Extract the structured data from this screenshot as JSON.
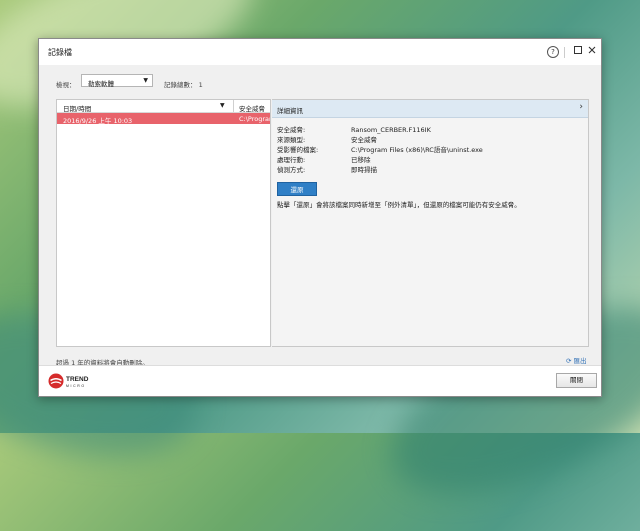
{
  "window": {
    "title": "記錄檔"
  },
  "filter": {
    "label": "檢視：",
    "selected": "勒索軟體"
  },
  "record_count": {
    "label": "記錄總數：",
    "value": "1"
  },
  "list": {
    "columns": [
      "日期/時間",
      "安全威脅"
    ],
    "rows": [
      {
        "datetime": "2016/9/26 上午 10:03",
        "threat": "C:\\Program"
      }
    ]
  },
  "detail": {
    "header": "詳細資訊",
    "fields": [
      {
        "key": "安全威脅:",
        "value": "Ransom_CERBER.F116IK"
      },
      {
        "key": "來源類型:",
        "value": "安全威脅"
      },
      {
        "key": "受影響的檔案:",
        "value": "C:\\Program Files (x86)\\RC語音\\uninst.exe"
      },
      {
        "key": "處理行動:",
        "value": "已移除"
      },
      {
        "key": "偵測方式:",
        "value": "即時掃描"
      }
    ],
    "restore_label": "還原",
    "note": "點擊「還原」會將該檔案同時新增至「例外清單」，但還原的檔案可能仍有安全威脅。"
  },
  "auto_delete_note": "超過 1 年的資料將會自動刪除。",
  "export_label": "匯出",
  "footer": {
    "brand_top": "TREND",
    "brand_bottom": "MICRO",
    "close_label": "關閉"
  },
  "colors": {
    "selected_row": "#e8636b",
    "restore_button": "#2f7fc6",
    "detail_header": "#dde9f3",
    "brand_red": "#d52b2b"
  }
}
